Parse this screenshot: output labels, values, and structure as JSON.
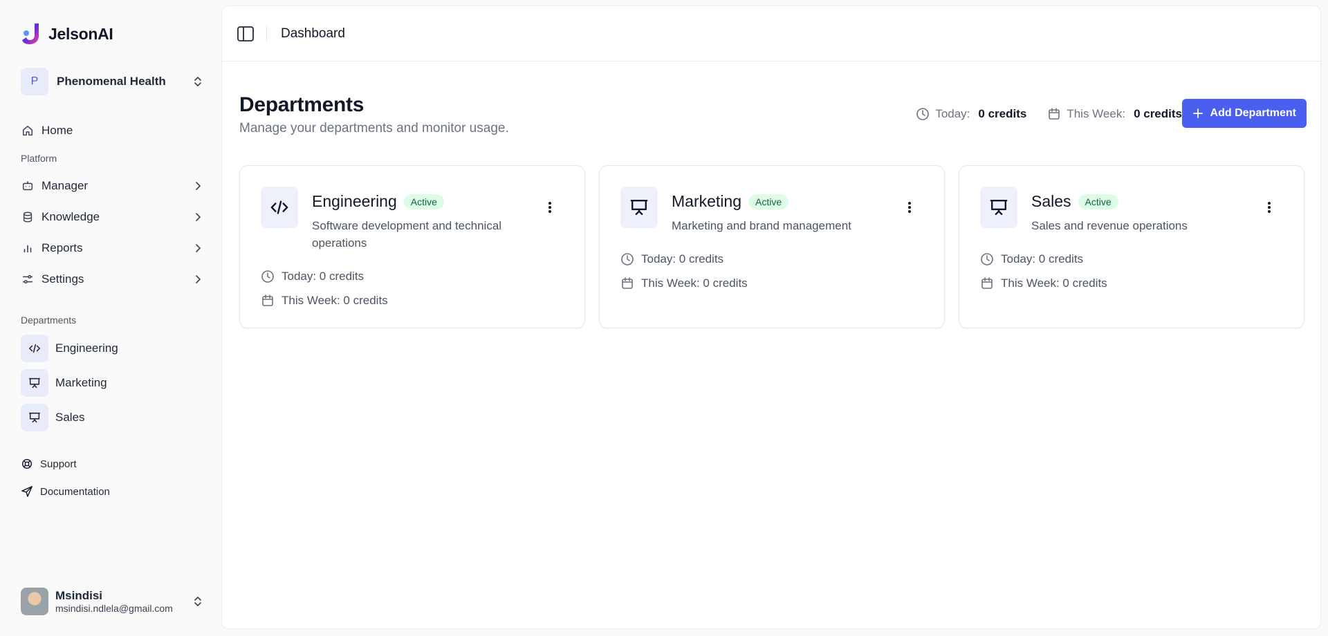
{
  "app": {
    "name": "JelsonAI"
  },
  "workspace": {
    "initial": "P",
    "name": "Phenomenal Health"
  },
  "nav": {
    "home": "Home",
    "platform_label": "Platform",
    "items": [
      {
        "label": "Manager",
        "icon": "bot-icon"
      },
      {
        "label": "Knowledge",
        "icon": "database-icon"
      },
      {
        "label": "Reports",
        "icon": "bar-chart-icon"
      },
      {
        "label": "Settings",
        "icon": "sliders-icon"
      }
    ],
    "departments_label": "Departments",
    "departments": [
      {
        "label": "Engineering",
        "icon": "code-icon"
      },
      {
        "label": "Marketing",
        "icon": "presentation-icon"
      },
      {
        "label": "Sales",
        "icon": "presentation-icon"
      }
    ],
    "support": "Support",
    "documentation": "Documentation"
  },
  "user": {
    "name": "Msindisi",
    "email": "msindisi.ndlela@gmail.com"
  },
  "topbar": {
    "breadcrumb": "Dashboard"
  },
  "page": {
    "title": "Departments",
    "subtitle": "Manage your departments and monitor usage.",
    "stats": {
      "today_label": "Today:",
      "today_value": "0 credits",
      "week_label": "This Week:",
      "week_value": "0 credits"
    },
    "add_button": "Add Department"
  },
  "cards": [
    {
      "title": "Engineering",
      "status": "Active",
      "description": "Software development and technical operations",
      "today": "Today: 0 credits",
      "week": "This Week: 0 credits",
      "icon": "code-icon"
    },
    {
      "title": "Marketing",
      "status": "Active",
      "description": "Marketing and brand management",
      "today": "Today: 0 credits",
      "week": "This Week: 0 credits",
      "icon": "presentation-icon"
    },
    {
      "title": "Sales",
      "status": "Active",
      "description": "Sales and revenue operations",
      "today": "Today: 0 credits",
      "week": "This Week: 0 credits",
      "icon": "presentation-icon"
    }
  ],
  "colors": {
    "accent": "#4a5ef0",
    "badge_bg": "#dcfce7",
    "badge_text": "#166534",
    "icon_box": "#e8ebfa"
  }
}
